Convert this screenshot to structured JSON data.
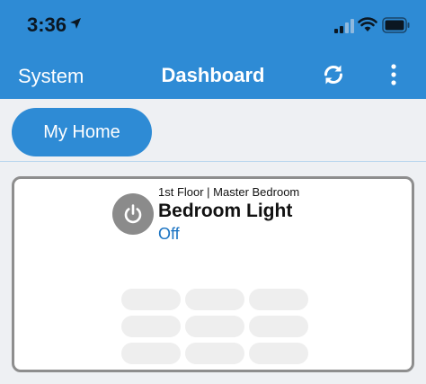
{
  "status_bar": {
    "time": "3:36",
    "icons": [
      "location-arrow-icon",
      "cellular-signal-icon",
      "wifi-icon",
      "battery-icon"
    ]
  },
  "nav": {
    "left_label": "System",
    "title": "Dashboard",
    "icons": [
      "refresh-icon",
      "more-vertical-icon"
    ]
  },
  "home": {
    "label": "My Home"
  },
  "device": {
    "location": "1st Floor | Master Bedroom",
    "name": "Bedroom Light",
    "status": "Off",
    "icon": "power-icon"
  },
  "colors": {
    "accent": "#2e8bd5",
    "status_text": "#1a73c2",
    "power_button": "#8b8b8b",
    "card_border": "#8e8e8e"
  }
}
